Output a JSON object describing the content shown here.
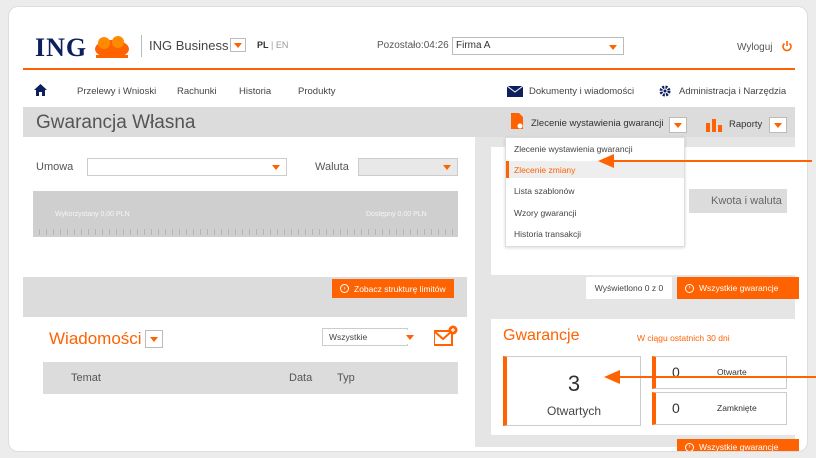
{
  "header": {
    "logo": "ING",
    "app_name": "ING Business",
    "lang_active": "PL",
    "lang_sep": "|",
    "lang_other": "EN",
    "remaining_label": "Pozostało:04:26",
    "company_value": "Firma A",
    "logout": "Wyloguj"
  },
  "nav": {
    "items": [
      "Przelewy i Wnioski",
      "Rachunki",
      "Historia",
      "Produkty"
    ],
    "documents": "Dokumenty i wiadomości",
    "admin": "Administracja i Narzędzia"
  },
  "page": {
    "title": "Gwarancja Własna",
    "new_request_button": "Zlecenie wystawienia gwarancji",
    "reports_button": "Raporty"
  },
  "dropdown_menu": {
    "items": [
      "Zlecenie wystawienia gwarancji",
      "Zlecenie zmiany",
      "Lista szablonów",
      "Wzory gwarancji",
      "Historia transakcji"
    ],
    "active_index": 1
  },
  "limits": {
    "contract_label": "Umowa",
    "currency_label": "Waluta",
    "used": "Wykorzystany 0,00 PLN",
    "available": "Dostępny 0,00 PLN",
    "structure_button": "Zobacz strukturę limitów"
  },
  "guarantees_table": {
    "amount_header": "Kwota i waluta",
    "shown": "Wyświetlono 0 z 0",
    "all_button": "Wszystkie gwarancje"
  },
  "messages": {
    "title": "Wiadomości",
    "filter_value": "Wszystkie",
    "columns": [
      "Temat",
      "Data",
      "Typ"
    ]
  },
  "guarantees": {
    "title": "Gwarancje",
    "period": "W ciągu ostatnich 30 dni",
    "open_count": "3",
    "open_label": "Otwartych",
    "stats": [
      {
        "count": "0",
        "label": "Otwarte"
      },
      {
        "count": "0",
        "label": "Zamknięte"
      }
    ],
    "more_button": "Wszystkie gwarancje"
  },
  "colors": {
    "accent": "#ff6200",
    "brand": "#0d1f5c"
  }
}
